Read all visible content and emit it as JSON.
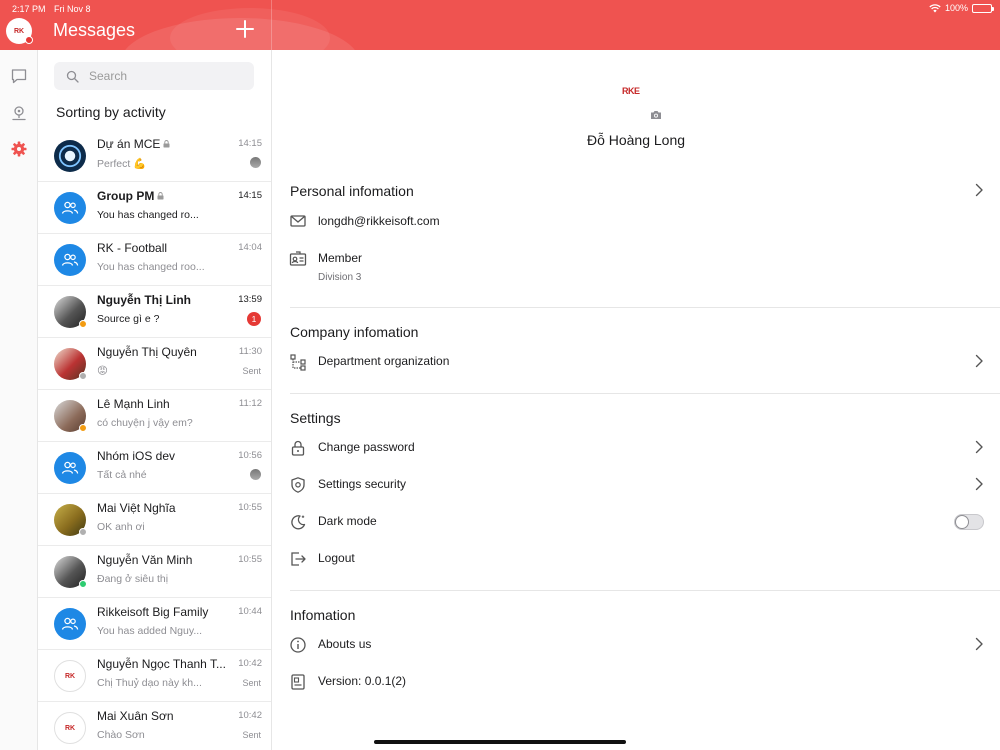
{
  "status_bar": {
    "time": "2:17 PM",
    "date": "Fri Nov 8",
    "battery": "100%"
  },
  "header": {
    "title": "Messages",
    "avatar_text": "RK"
  },
  "rail": {
    "items": [
      {
        "icon": "chat-bubble-icon",
        "active": false
      },
      {
        "icon": "location-pin-icon",
        "active": false
      },
      {
        "icon": "gear-icon",
        "active": true
      }
    ]
  },
  "search": {
    "placeholder": "Search"
  },
  "list": {
    "title": "Sorting by activity",
    "conversations": [
      {
        "name": "Dự án MCE",
        "preview": "Perfect 💪",
        "time": "14:15",
        "locked": true,
        "bold": false,
        "avatar": "gear-photo",
        "meta": "seen-avatar"
      },
      {
        "name": "Group PM",
        "preview": "You has changed ro...",
        "time": "14:15",
        "locked": true,
        "bold": true,
        "avatar": "group"
      },
      {
        "name": "RK - Football",
        "preview": "You has changed roo...",
        "time": "14:04",
        "locked": false,
        "bold": false,
        "avatar": "group"
      },
      {
        "name": "Nguyễn Thị Linh",
        "preview": "Source gì e ?",
        "time": "13:59",
        "locked": false,
        "bold": true,
        "avatar": "photo",
        "badge": "1",
        "presence": "#f39c12"
      },
      {
        "name": "Nguyễn Thị Quyên",
        "preview": "😡",
        "time": "11:30",
        "locked": false,
        "bold": false,
        "avatar": "photo",
        "meta": "Sent",
        "presence": "#b0b0b0"
      },
      {
        "name": "Lê Mạnh Linh",
        "preview": "có chuyện j vậy em?",
        "time": "11:12",
        "locked": false,
        "bold": false,
        "avatar": "photo",
        "presence": "#f39c12"
      },
      {
        "name": "Nhóm iOS dev",
        "preview": "Tất cả nhé",
        "time": "10:56",
        "locked": false,
        "bold": false,
        "avatar": "group",
        "meta": "seen-avatar"
      },
      {
        "name": "Mai Việt Nghĩa",
        "preview": "OK anh ơi",
        "time": "10:55",
        "locked": false,
        "bold": false,
        "avatar": "photo",
        "presence": "#b0b0b0"
      },
      {
        "name": "Nguyễn Văn Minh",
        "preview": "Đang ở siêu thị",
        "time": "10:55",
        "locked": false,
        "bold": false,
        "avatar": "photo",
        "presence": "#2ecc71"
      },
      {
        "name": "Rikkeisoft Big Family",
        "preview": "You has added Nguy...",
        "time": "10:44",
        "locked": false,
        "bold": false,
        "avatar": "group"
      },
      {
        "name": "Nguyễn Ngọc Thanh T...",
        "preview": "Chị Thuỷ dạo này kh...",
        "time": "10:42",
        "locked": false,
        "bold": false,
        "avatar": "logo",
        "meta": "Sent"
      },
      {
        "name": "Mai Xuân Sơn",
        "preview": "Chào Sơn",
        "time": "10:42",
        "locked": false,
        "bold": false,
        "avatar": "logo",
        "meta": "Sent"
      }
    ]
  },
  "profile": {
    "logo_text": "RKE",
    "name": "Đỗ Hoàng Long",
    "personal": {
      "title": "Personal infomation",
      "email": "longdh@rikkeisoft.com",
      "role": "Member",
      "division": "Division 3"
    },
    "company": {
      "title": "Company infomation",
      "department": "Department organization"
    },
    "settings": {
      "title": "Settings",
      "change_password": "Change password",
      "security": "Settings security",
      "dark_mode": "Dark mode",
      "dark_mode_on": false,
      "logout": "Logout"
    },
    "info": {
      "title": "Infomation",
      "about": "Abouts us",
      "version": "Version: 0.0.1(2)"
    }
  },
  "colors": {
    "accent": "#ef5350",
    "group_avatar": "#1e88e5",
    "badge": "#e53935"
  }
}
